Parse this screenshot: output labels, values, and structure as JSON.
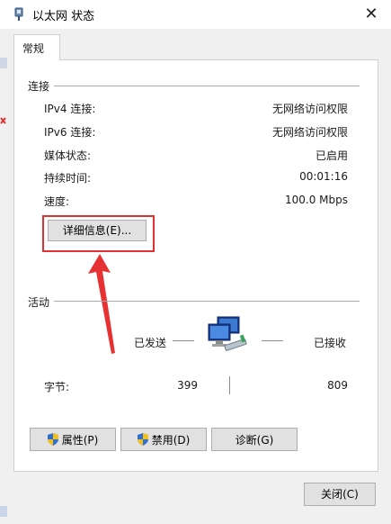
{
  "window": {
    "title": "以太网 状态",
    "close_glyph": "✕"
  },
  "tabs": [
    {
      "label": "常规"
    }
  ],
  "connection": {
    "group_label": "连接",
    "rows": [
      {
        "label": "IPv4 连接:",
        "value": "无网络访问权限"
      },
      {
        "label": "IPv6 连接:",
        "value": "无网络访问权限"
      },
      {
        "label": "媒体状态:",
        "value": "已启用"
      },
      {
        "label": "持续时间:",
        "value": "00:01:16"
      },
      {
        "label": "速度:",
        "value": "100.0 Mbps"
      }
    ],
    "details_button": "详细信息(E)..."
  },
  "activity": {
    "group_label": "活动",
    "sent_label": "已发送",
    "received_label": "已接收",
    "bytes_label": "字节:",
    "bytes_sent": "399",
    "bytes_received": "809"
  },
  "buttons": {
    "properties": "属性(P)",
    "disable": "禁用(D)",
    "diagnose": "诊断(G)",
    "close": "关闭(C)"
  },
  "annotations": {
    "highlight_color": "#e03030"
  },
  "icons": {
    "title": "network-adapter-icon",
    "shield": "uac-shield-icon",
    "activity": "network-computers-icon"
  }
}
